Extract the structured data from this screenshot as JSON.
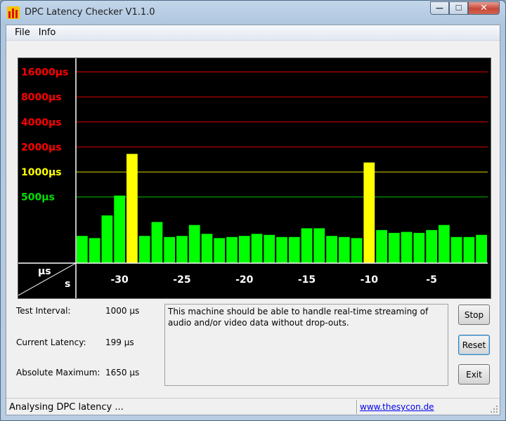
{
  "window": {
    "title": "DPC Latency Checker V1.1.0"
  },
  "caption": {
    "minimize": "—",
    "maximize": "☐",
    "close": "✕"
  },
  "menu": [
    {
      "label": "File"
    },
    {
      "label": "Info"
    }
  ],
  "chart_data": {
    "type": "bar",
    "y_unit_label": "µs",
    "x_unit_label": "s",
    "y_scale": "log",
    "y_ticks": [
      {
        "label": "16000µs",
        "value": 16000,
        "color": "#ff0000"
      },
      {
        "label": "8000µs",
        "value": 8000,
        "color": "#ff0000"
      },
      {
        "label": "4000µs",
        "value": 4000,
        "color": "#ff0000"
      },
      {
        "label": "2000µs",
        "value": 2000,
        "color": "#ff0000"
      },
      {
        "label": "1000µs",
        "value": 1000,
        "color": "#ffff00"
      },
      {
        "label": "500µs",
        "value": 500,
        "color": "#00e000"
      }
    ],
    "x_ticks": [
      {
        "label": "-30",
        "value": -30
      },
      {
        "label": "-25",
        "value": -25
      },
      {
        "label": "-20",
        "value": -20
      },
      {
        "label": "-15",
        "value": -15
      },
      {
        "label": "-10",
        "value": -10
      },
      {
        "label": "-5",
        "value": -5
      }
    ],
    "x_range": [
      -33,
      0
    ],
    "y_range": [
      80,
      20000
    ],
    "bar_colors": {
      "normal": "#00ff00",
      "warning": "#ffff00"
    },
    "warning_threshold": 1000,
    "x": [
      -33,
      -32,
      -31,
      -30,
      -29,
      -28,
      -27,
      -26,
      -25,
      -24,
      -23,
      -22,
      -21,
      -20,
      -19,
      -18,
      -17,
      -16,
      -15,
      -14,
      -13,
      -12,
      -11,
      -10,
      -9,
      -8,
      -7,
      -6,
      -5,
      -4,
      -3,
      -2,
      -1
    ],
    "values": [
      170,
      160,
      300,
      520,
      1650,
      170,
      250,
      165,
      170,
      230,
      180,
      160,
      165,
      170,
      180,
      175,
      165,
      165,
      210,
      210,
      170,
      165,
      160,
      1300,
      200,
      185,
      190,
      185,
      200,
      230,
      165,
      165,
      175
    ]
  },
  "info": {
    "test_interval_label": "Test Interval:",
    "test_interval_value": "1000 µs",
    "current_latency_label": "Current Latency:",
    "current_latency_value": "199 µs",
    "absolute_max_label": "Absolute Maximum:",
    "absolute_max_value": "1650 µs"
  },
  "message": "This machine should be able to handle real-time streaming of audio and/or video data without drop-outs.",
  "buttons": {
    "stop": "Stop",
    "reset": "Reset",
    "exit": "Exit"
  },
  "status": {
    "text": "Analysing DPC latency ...",
    "link": "www.thesycon.de"
  }
}
